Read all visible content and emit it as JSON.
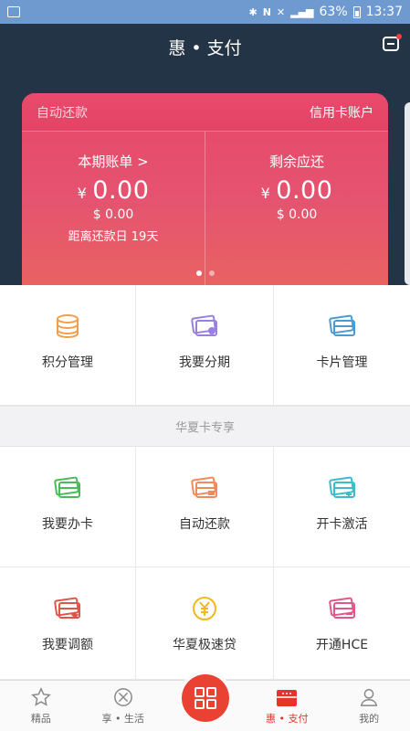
{
  "status_bar": {
    "battery": "63%",
    "time": "13:37"
  },
  "header": {
    "title": "惠 • 支付"
  },
  "card": {
    "auto_repay": "自动还款",
    "account": "信用卡账户",
    "left": {
      "title": "本期账单 >",
      "currency": "¥",
      "amount": "0.00",
      "usd": "$ 0.00",
      "due": "距离还款日 19天"
    },
    "right": {
      "title": "剩余应还",
      "currency": "¥",
      "amount": "0.00",
      "usd": "$ 0.00"
    }
  },
  "services": [
    {
      "label": "积分管理",
      "icon": "coins-icon",
      "color": "#f0a04b"
    },
    {
      "label": "我要分期",
      "icon": "card-installment-icon",
      "color": "#9b7fe0"
    },
    {
      "label": "卡片管理",
      "icon": "cards-icon",
      "color": "#4a9ad4"
    }
  ],
  "section_title": "华夏卡专享",
  "exclusive": [
    {
      "label": "我要办卡",
      "icon": "apply-card-icon",
      "color": "#4cba5a"
    },
    {
      "label": "自动还款",
      "icon": "auto-repay-icon",
      "color": "#f08a5a"
    },
    {
      "label": "开卡激活",
      "icon": "activate-card-icon",
      "color": "#3cbcc8"
    },
    {
      "label": "我要调额",
      "icon": "adjust-limit-icon",
      "color": "#e0554a"
    },
    {
      "label": "华夏极速贷",
      "icon": "yuan-loan-icon",
      "color": "#f2b81c"
    },
    {
      "label": "开通HCE",
      "icon": "hce-card-icon",
      "color": "#e0588a"
    }
  ],
  "tabs": [
    {
      "label": "精品",
      "icon": "star-icon"
    },
    {
      "label": "享 • 生活",
      "icon": "life-icon"
    },
    {
      "label": "",
      "icon": "grid-icon"
    },
    {
      "label": "惠 • 支付",
      "icon": "wallet-icon",
      "active": true
    },
    {
      "label": "我的",
      "icon": "person-icon"
    }
  ],
  "colors": {
    "header_bg": "#243447",
    "card_pink": "#e9476b",
    "accent_red": "#ea4232"
  }
}
